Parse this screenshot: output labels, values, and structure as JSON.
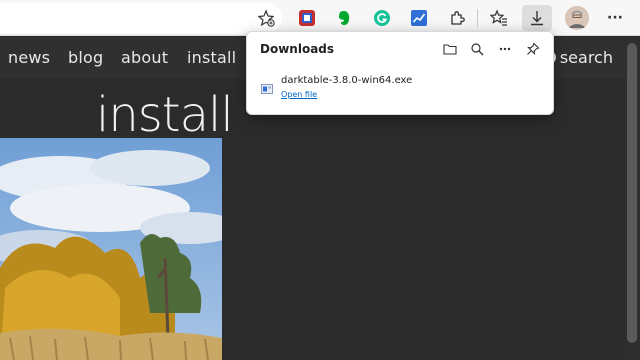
{
  "browser": {
    "toolbar_icons": [
      "favorites-add-icon",
      "extension-red-icon",
      "evernote-icon",
      "grammarly-icon",
      "chart-extension-icon",
      "extensions-icon",
      "favorites-icon",
      "download-icon",
      "profile-avatar",
      "more-icon"
    ],
    "more_label": "···"
  },
  "site": {
    "nav": [
      "news",
      "blog",
      "about",
      "install"
    ],
    "search_label": "search",
    "page_title": "install"
  },
  "downloads": {
    "title": "Downloads",
    "items": [
      {
        "file_name": "darktable-3.8.0-win64.exe",
        "action": "Open file"
      }
    ]
  },
  "colors": {
    "site_bg": "#2b2b2b",
    "link_blue": "#0067c0",
    "panel_bg": "#ffffff"
  }
}
